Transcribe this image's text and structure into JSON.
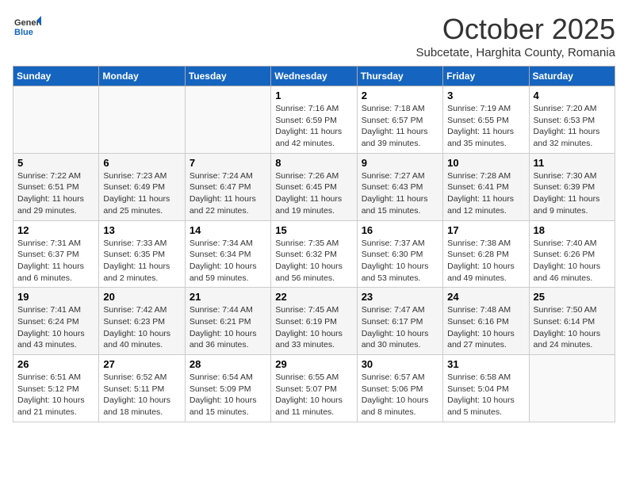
{
  "logo": {
    "general": "General",
    "blue": "Blue"
  },
  "title": "October 2025",
  "subtitle": "Subcetate, Harghita County, Romania",
  "days_of_week": [
    "Sunday",
    "Monday",
    "Tuesday",
    "Wednesday",
    "Thursday",
    "Friday",
    "Saturday"
  ],
  "weeks": [
    [
      {
        "day": "",
        "content": ""
      },
      {
        "day": "",
        "content": ""
      },
      {
        "day": "",
        "content": ""
      },
      {
        "day": "1",
        "content": "Sunrise: 7:16 AM\nSunset: 6:59 PM\nDaylight: 11 hours\nand 42 minutes."
      },
      {
        "day": "2",
        "content": "Sunrise: 7:18 AM\nSunset: 6:57 PM\nDaylight: 11 hours\nand 39 minutes."
      },
      {
        "day": "3",
        "content": "Sunrise: 7:19 AM\nSunset: 6:55 PM\nDaylight: 11 hours\nand 35 minutes."
      },
      {
        "day": "4",
        "content": "Sunrise: 7:20 AM\nSunset: 6:53 PM\nDaylight: 11 hours\nand 32 minutes."
      }
    ],
    [
      {
        "day": "5",
        "content": "Sunrise: 7:22 AM\nSunset: 6:51 PM\nDaylight: 11 hours\nand 29 minutes."
      },
      {
        "day": "6",
        "content": "Sunrise: 7:23 AM\nSunset: 6:49 PM\nDaylight: 11 hours\nand 25 minutes."
      },
      {
        "day": "7",
        "content": "Sunrise: 7:24 AM\nSunset: 6:47 PM\nDaylight: 11 hours\nand 22 minutes."
      },
      {
        "day": "8",
        "content": "Sunrise: 7:26 AM\nSunset: 6:45 PM\nDaylight: 11 hours\nand 19 minutes."
      },
      {
        "day": "9",
        "content": "Sunrise: 7:27 AM\nSunset: 6:43 PM\nDaylight: 11 hours\nand 15 minutes."
      },
      {
        "day": "10",
        "content": "Sunrise: 7:28 AM\nSunset: 6:41 PM\nDaylight: 11 hours\nand 12 minutes."
      },
      {
        "day": "11",
        "content": "Sunrise: 7:30 AM\nSunset: 6:39 PM\nDaylight: 11 hours\nand 9 minutes."
      }
    ],
    [
      {
        "day": "12",
        "content": "Sunrise: 7:31 AM\nSunset: 6:37 PM\nDaylight: 11 hours\nand 6 minutes."
      },
      {
        "day": "13",
        "content": "Sunrise: 7:33 AM\nSunset: 6:35 PM\nDaylight: 11 hours\nand 2 minutes."
      },
      {
        "day": "14",
        "content": "Sunrise: 7:34 AM\nSunset: 6:34 PM\nDaylight: 10 hours\nand 59 minutes."
      },
      {
        "day": "15",
        "content": "Sunrise: 7:35 AM\nSunset: 6:32 PM\nDaylight: 10 hours\nand 56 minutes."
      },
      {
        "day": "16",
        "content": "Sunrise: 7:37 AM\nSunset: 6:30 PM\nDaylight: 10 hours\nand 53 minutes."
      },
      {
        "day": "17",
        "content": "Sunrise: 7:38 AM\nSunset: 6:28 PM\nDaylight: 10 hours\nand 49 minutes."
      },
      {
        "day": "18",
        "content": "Sunrise: 7:40 AM\nSunset: 6:26 PM\nDaylight: 10 hours\nand 46 minutes."
      }
    ],
    [
      {
        "day": "19",
        "content": "Sunrise: 7:41 AM\nSunset: 6:24 PM\nDaylight: 10 hours\nand 43 minutes."
      },
      {
        "day": "20",
        "content": "Sunrise: 7:42 AM\nSunset: 6:23 PM\nDaylight: 10 hours\nand 40 minutes."
      },
      {
        "day": "21",
        "content": "Sunrise: 7:44 AM\nSunset: 6:21 PM\nDaylight: 10 hours\nand 36 minutes."
      },
      {
        "day": "22",
        "content": "Sunrise: 7:45 AM\nSunset: 6:19 PM\nDaylight: 10 hours\nand 33 minutes."
      },
      {
        "day": "23",
        "content": "Sunrise: 7:47 AM\nSunset: 6:17 PM\nDaylight: 10 hours\nand 30 minutes."
      },
      {
        "day": "24",
        "content": "Sunrise: 7:48 AM\nSunset: 6:16 PM\nDaylight: 10 hours\nand 27 minutes."
      },
      {
        "day": "25",
        "content": "Sunrise: 7:50 AM\nSunset: 6:14 PM\nDaylight: 10 hours\nand 24 minutes."
      }
    ],
    [
      {
        "day": "26",
        "content": "Sunrise: 6:51 AM\nSunset: 5:12 PM\nDaylight: 10 hours\nand 21 minutes."
      },
      {
        "day": "27",
        "content": "Sunrise: 6:52 AM\nSunset: 5:11 PM\nDaylight: 10 hours\nand 18 minutes."
      },
      {
        "day": "28",
        "content": "Sunrise: 6:54 AM\nSunset: 5:09 PM\nDaylight: 10 hours\nand 15 minutes."
      },
      {
        "day": "29",
        "content": "Sunrise: 6:55 AM\nSunset: 5:07 PM\nDaylight: 10 hours\nand 11 minutes."
      },
      {
        "day": "30",
        "content": "Sunrise: 6:57 AM\nSunset: 5:06 PM\nDaylight: 10 hours\nand 8 minutes."
      },
      {
        "day": "31",
        "content": "Sunrise: 6:58 AM\nSunset: 5:04 PM\nDaylight: 10 hours\nand 5 minutes."
      },
      {
        "day": "",
        "content": ""
      }
    ]
  ]
}
